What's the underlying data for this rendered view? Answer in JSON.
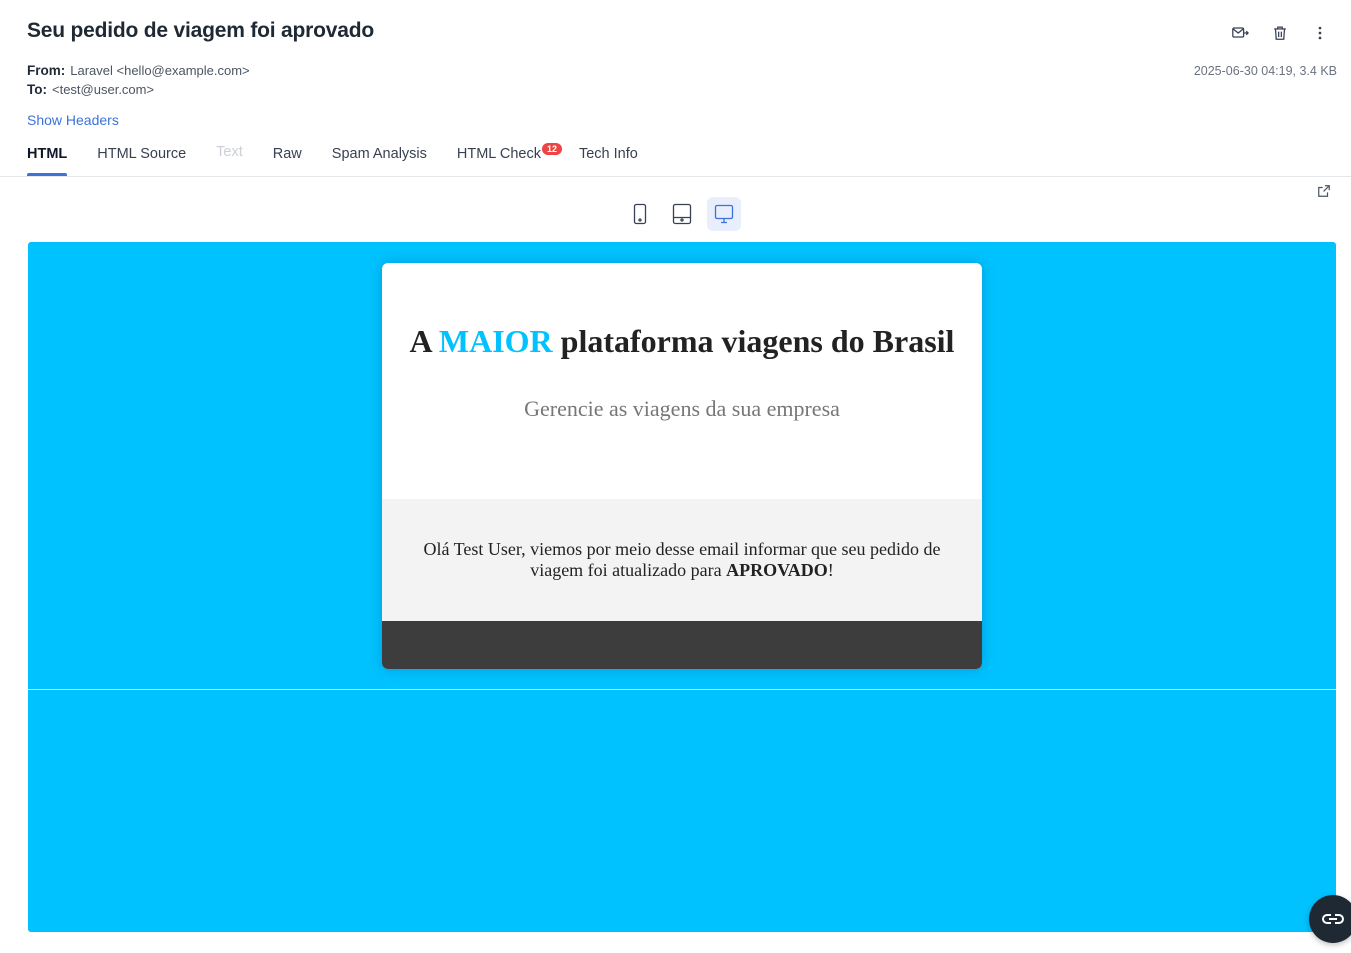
{
  "message": {
    "subject": "Seu pedido de viagem foi aprovado",
    "from_label": "From:",
    "from_value": "Laravel <hello@example.com>",
    "to_label": "To:",
    "to_value": "<test@user.com>",
    "date_size": "2025-06-30 04:19, 3.4 KB",
    "show_headers": "Show Headers"
  },
  "actions": {
    "icons": [
      "mail-forward-icon",
      "trash-icon",
      "more-vertical-icon"
    ]
  },
  "tabs": [
    {
      "label": "HTML",
      "state": "active"
    },
    {
      "label": "HTML Source",
      "state": "normal"
    },
    {
      "label": "Text",
      "state": "disabled"
    },
    {
      "label": "Raw",
      "state": "normal"
    },
    {
      "label": "Spam Analysis",
      "state": "normal"
    },
    {
      "label": "HTML Check",
      "state": "normal",
      "badge": "12"
    },
    {
      "label": "Tech Info",
      "state": "normal"
    }
  ],
  "device_toggle": {
    "options": [
      "mobile",
      "tablet",
      "desktop"
    ],
    "selected": "desktop"
  },
  "email": {
    "headline_before": "A ",
    "headline_accent": "MAIOR",
    "headline_after": " plataforma viagens do Brasil",
    "tagline": "Gerencie as viagens da sua empresa",
    "body_text": "Olá Test User, viemos por meio desse email informar que seu pedido de viagem foi atualizado para ",
    "body_strong": "APROVADO",
    "body_end": "!"
  },
  "colors": {
    "accent": "#3b73d9",
    "email_background": "#00c2ff",
    "footer": "#3d3d3d",
    "badge": "#ef4444"
  }
}
